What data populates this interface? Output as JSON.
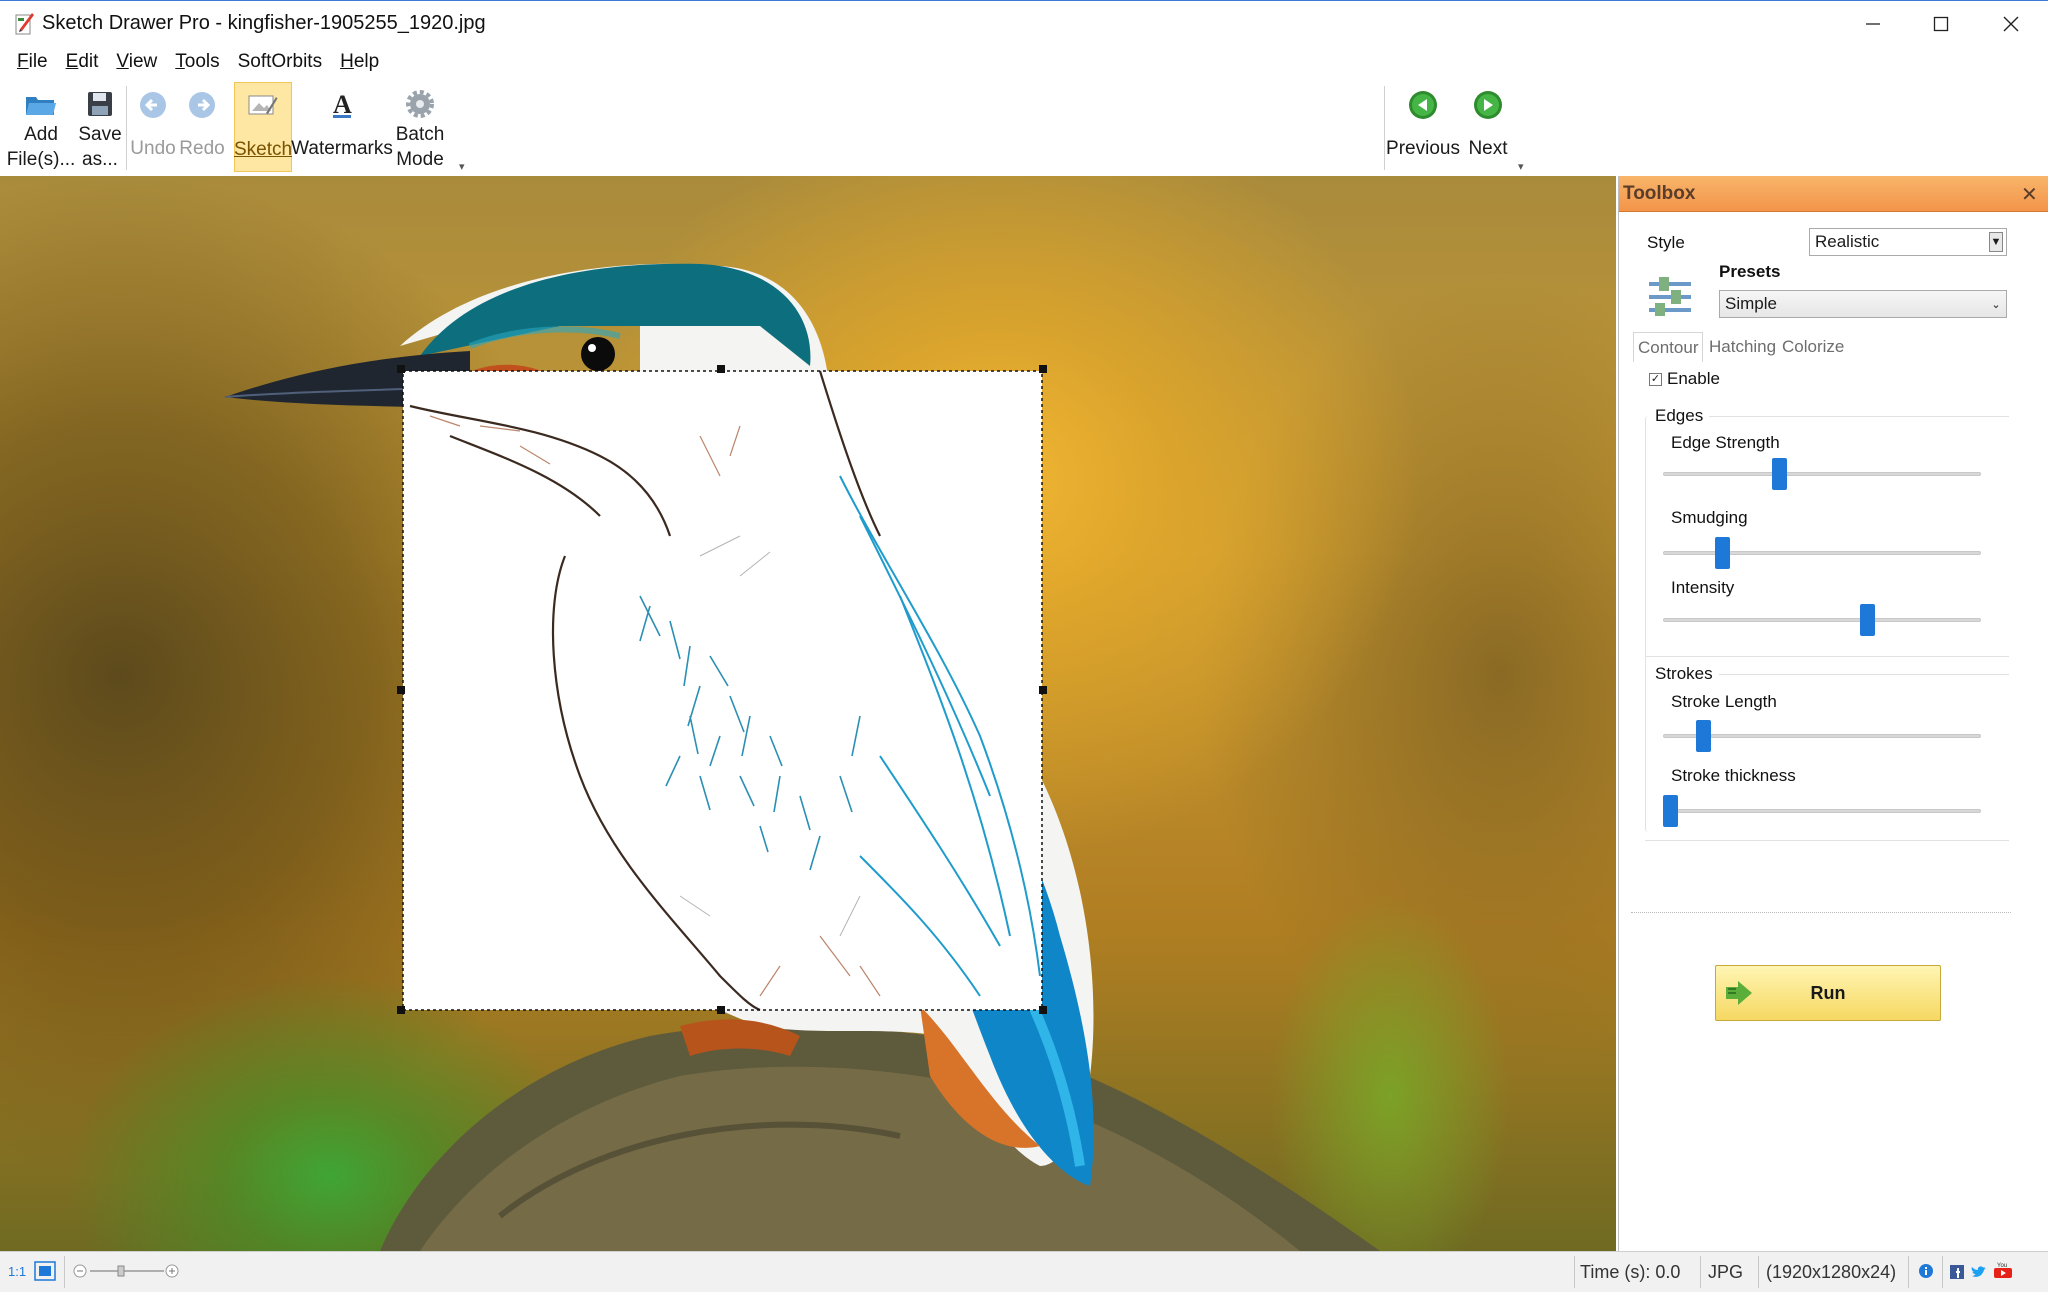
{
  "window": {
    "title": "Sketch Drawer Pro - kingfisher-1905255_1920.jpg"
  },
  "menu": [
    {
      "label": "File",
      "key": "F",
      "rest": "ile"
    },
    {
      "label": "Edit",
      "key": "E",
      "rest": "dit"
    },
    {
      "label": "View",
      "key": "V",
      "rest": "iew"
    },
    {
      "label": "Tools",
      "key": "T",
      "rest": "ools"
    },
    {
      "label": "SoftOrbits",
      "key": "",
      "rest": "SoftOrbits"
    },
    {
      "label": "Help",
      "key": "H",
      "rest": "elp"
    }
  ],
  "toolbar": {
    "add_files": [
      "Add",
      "File(s)..."
    ],
    "save_as": [
      "Save",
      "as..."
    ],
    "undo": "Undo",
    "redo": "Redo",
    "sketch": "Sketch",
    "watermarks": "Watermarks",
    "batch_mode": [
      "Batch",
      "Mode"
    ],
    "previous": "Previous",
    "next": "Next"
  },
  "toolbox": {
    "title": "Toolbox",
    "style_label": "Style",
    "style_value": "Realistic",
    "presets_label": "Presets",
    "presets_value": "Simple",
    "tabs": [
      "Contour",
      "Hatching",
      "Colorize"
    ],
    "enable_label": "Enable",
    "enable_checked": true,
    "edges_group": "Edges",
    "strokes_group": "Strokes",
    "sliders": [
      {
        "label": "Edge Strength",
        "value": 0.36
      },
      {
        "label": "Smudging",
        "value": 0.17
      },
      {
        "label": "Intensity",
        "value": 0.65
      },
      {
        "label": "Stroke Length",
        "value": 0.11
      },
      {
        "label": "Stroke thickness",
        "value": 0.0
      }
    ],
    "run_label": "Run"
  },
  "status": {
    "zoom_label": "1:1",
    "time": "Time (s): 0.0",
    "format": "JPG",
    "dimensions": "(1920x1280x24)"
  },
  "colors": {
    "accent_blue": "#1e78d7",
    "toolbox_header": "#f3954a",
    "run_button": "#f6d862",
    "selected_tool": "#fde7a3"
  }
}
